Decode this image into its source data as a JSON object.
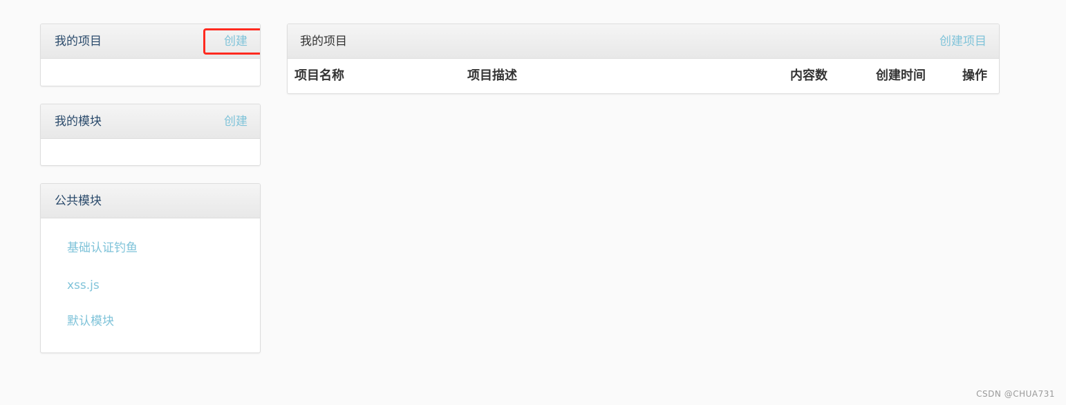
{
  "sidebar": {
    "my_projects": {
      "title": "我的项目",
      "create_label": "创建"
    },
    "my_modules": {
      "title": "我的模块",
      "create_label": "创建"
    },
    "public_modules": {
      "title": "公共模块",
      "items": [
        {
          "label": "基础认证钓鱼"
        },
        {
          "label": "xss.js"
        },
        {
          "label": "默认模块"
        }
      ]
    }
  },
  "main": {
    "title": "我的项目",
    "create_label": "创建项目",
    "table": {
      "columns": [
        "项目名称",
        "项目描述",
        "内容数",
        "创建时间",
        "操作"
      ]
    }
  },
  "watermark": "CSDN @CHUA731",
  "colors": {
    "link": "#7fc3d9",
    "title": "#2a4a6b",
    "highlight": "#ff2a1f"
  }
}
